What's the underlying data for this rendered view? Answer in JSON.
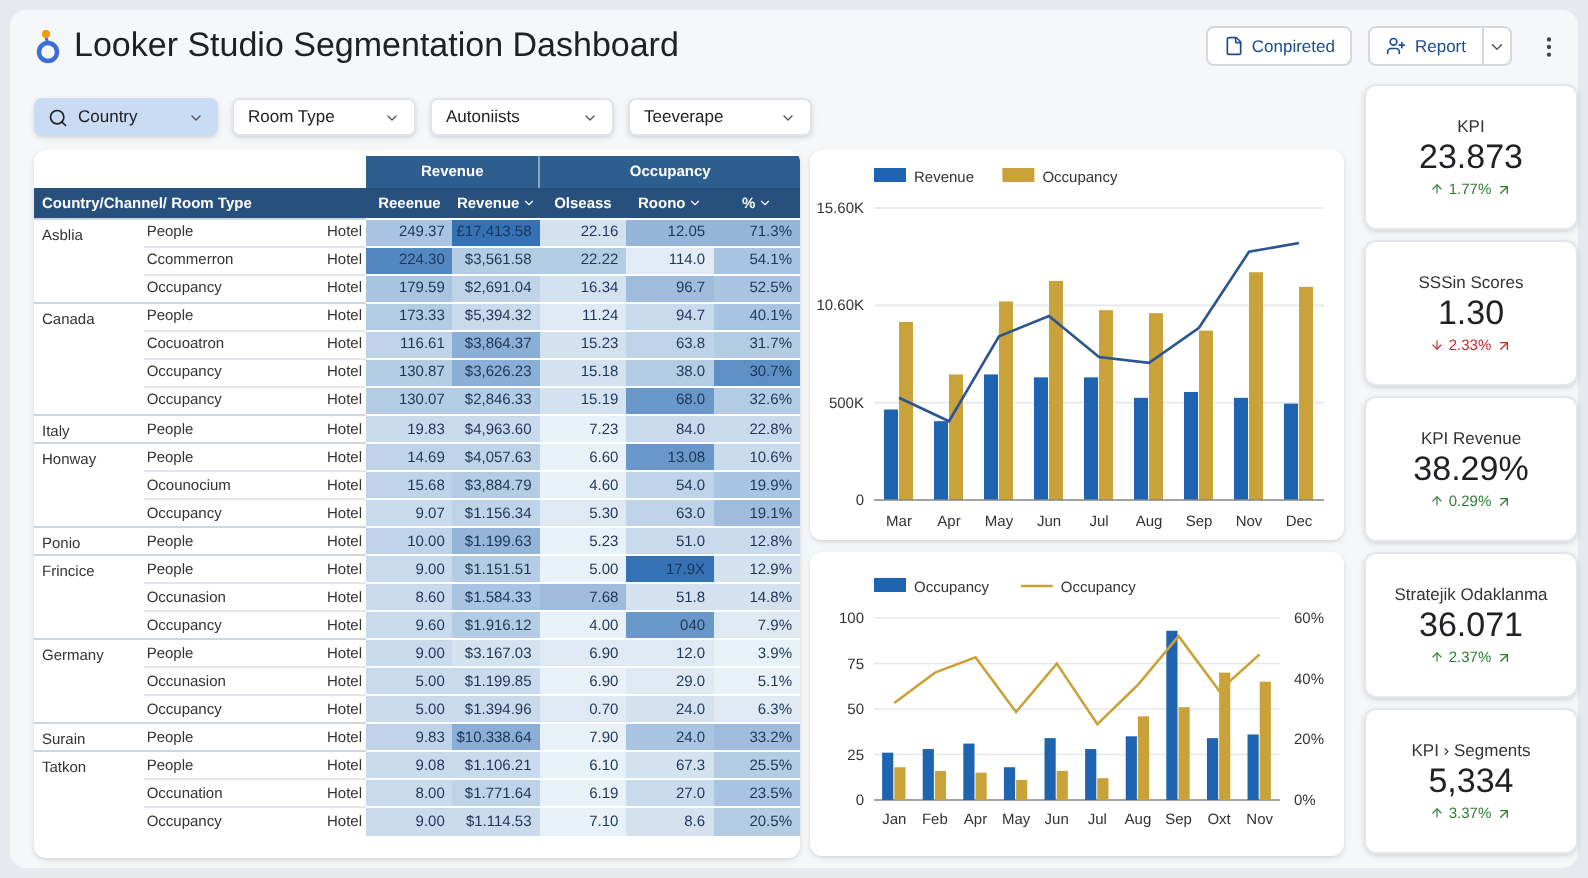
{
  "header": {
    "title": "Looker Studio Segmentation Dashboard",
    "buttons": [
      {
        "label": "Conpireted",
        "kind": "file",
        "split": false
      },
      {
        "label": "Report",
        "kind": "share",
        "split": true
      }
    ]
  },
  "filters": [
    {
      "label": "Country",
      "selected": true,
      "kind": "search"
    },
    {
      "label": "Room Type",
      "selected": false,
      "kind": "plain"
    },
    {
      "label": "Autoniists",
      "selected": false,
      "kind": "plain"
    },
    {
      "label": "Teeverape",
      "selected": false,
      "kind": "plain"
    }
  ],
  "table": {
    "group_headers": [
      "Revenue",
      "Occupancy"
    ],
    "row_header": "Country/Channel/ Room Type",
    "columns": [
      {
        "label": "Reeenue",
        "sortable": false
      },
      {
        "label": "Revenue",
        "sortable": true
      },
      {
        "label": "Olseass",
        "sortable": false
      },
      {
        "label": "Roono",
        "sortable": true
      },
      {
        "label": "%",
        "sortable": true
      }
    ],
    "groups": [
      {
        "country": "Asblia",
        "rows": [
          {
            "channel": "People",
            "type": "Hotel",
            "cells": [
              {
                "text": "249.37",
                "color": "#a9c4e0"
              },
              {
                "text": "£17,413.58",
                "color": "#3472b5"
              },
              {
                "text": "22.16",
                "color": "#d4e2f0"
              },
              {
                "text": "12.05",
                "color": "#94b5d8"
              },
              {
                "text": "71.3%",
                "color": "#94b5d8"
              }
            ]
          },
          {
            "channel": "Ccommerron",
            "type": "Hotel",
            "cells": [
              {
                "text": "224.30",
                "color": "#5488c1"
              },
              {
                "text": "$3,561.58",
                "color": "#b4cbe4"
              },
              {
                "text": "22.22",
                "color": "#b4cbe4"
              },
              {
                "text": "114.0",
                "color": "#e3ecf6"
              },
              {
                "text": "54.1%",
                "color": "#a9c4e0"
              }
            ]
          },
          {
            "channel": "Occupancy",
            "type": "Hotel",
            "cells": [
              {
                "text": "179.59",
                "color": "#a9c4e0"
              },
              {
                "text": "$2,691.04",
                "color": "#bfd3e8"
              },
              {
                "text": "16.34",
                "color": "#d4e2f0"
              },
              {
                "text": "96.7",
                "color": "#9fbcdc"
              },
              {
                "text": "52.5%",
                "color": "#a9c4e0"
              }
            ]
          }
        ]
      },
      {
        "country": "Canada",
        "rows": [
          {
            "channel": "People",
            "type": "Hotel",
            "cells": [
              {
                "text": "173.33",
                "color": "#b4cbe4"
              },
              {
                "text": "$5,394.32",
                "color": "#c9daec"
              },
              {
                "text": "11.24",
                "color": "#dfe9f4"
              },
              {
                "text": "94.7",
                "color": "#c9daec"
              },
              {
                "text": "40.1%",
                "color": "#a9c4e0"
              }
            ]
          },
          {
            "channel": "Cocuoatron",
            "type": "Hotel",
            "cells": [
              {
                "text": "116.61",
                "color": "#bfd3e8"
              },
              {
                "text": "$3,864.37",
                "color": "#8aaed5"
              },
              {
                "text": "15.23",
                "color": "#d4e2f0"
              },
              {
                "text": "63.8",
                "color": "#bfd3e8"
              },
              {
                "text": "31.7%",
                "color": "#b4cbe4"
              }
            ]
          },
          {
            "channel": "Occupancy",
            "type": "Hotel",
            "cells": [
              {
                "text": "130.87",
                "color": "#b4cbe4"
              },
              {
                "text": "$3,626.23",
                "color": "#8aaed5"
              },
              {
                "text": "15.18",
                "color": "#d4e2f0"
              },
              {
                "text": "38.0",
                "color": "#b4cbe4"
              },
              {
                "text": "30.7%",
                "color": "#5f90c5"
              }
            ]
          },
          {
            "channel": "Occupancy",
            "type": "Hotel",
            "cells": [
              {
                "text": "130.07",
                "color": "#b4cbe4"
              },
              {
                "text": "$2,846.33",
                "color": "#b4cbe4"
              },
              {
                "text": "15.19",
                "color": "#d4e2f0"
              },
              {
                "text": "68.0",
                "color": "#6a97c9"
              },
              {
                "text": "32.6%",
                "color": "#b4cbe4"
              }
            ]
          }
        ]
      },
      {
        "country": "Italy",
        "rows": [
          {
            "channel": "People",
            "type": "Hotel",
            "cells": [
              {
                "text": "19.83",
                "color": "#c9daec"
              },
              {
                "text": "$4,963.60",
                "color": "#c9daec"
              },
              {
                "text": "7.23",
                "color": "#e9f1f8"
              },
              {
                "text": "84.0",
                "color": "#c9daec"
              },
              {
                "text": "22.8%",
                "color": "#c9daec"
              }
            ]
          }
        ]
      },
      {
        "country": "Honway",
        "rows": [
          {
            "channel": "People",
            "type": "Hotel",
            "cells": [
              {
                "text": "14.69",
                "color": "#bfd3e8"
              },
              {
                "text": "$4,057.63",
                "color": "#bfd3e8"
              },
              {
                "text": "6.60",
                "color": "#e9f1f8"
              },
              {
                "text": "13.08",
                "color": "#6a97c9"
              },
              {
                "text": "10.6%",
                "color": "#c9daec"
              }
            ]
          },
          {
            "channel": "Ocounocium",
            "type": "Hotel",
            "cells": [
              {
                "text": "15.68",
                "color": "#bfd3e8"
              },
              {
                "text": "$3,884.79",
                "color": "#b4cbe4"
              },
              {
                "text": "4.60",
                "color": "#e9f1f8"
              },
              {
                "text": "54.0",
                "color": "#bfd3e8"
              },
              {
                "text": "19.9%",
                "color": "#a9c4e0"
              }
            ]
          },
          {
            "channel": "Occupancy",
            "type": "Hotel",
            "cells": [
              {
                "text": "9.07",
                "color": "#c9daec"
              },
              {
                "text": "$1.156.34",
                "color": "#bfd3e8"
              },
              {
                "text": "5.30",
                "color": "#dfe9f4"
              },
              {
                "text": "63.0",
                "color": "#bfd3e8"
              },
              {
                "text": "19.1%",
                "color": "#9fbcdc"
              }
            ]
          }
        ]
      },
      {
        "country": "Ponio",
        "rows": [
          {
            "channel": "People",
            "type": "Hotel",
            "cells": [
              {
                "text": "10.00",
                "color": "#bfd3e8"
              },
              {
                "text": "$1.199.63",
                "color": "#94b5d8"
              },
              {
                "text": "5.23",
                "color": "#e9f1f8"
              },
              {
                "text": "51.0",
                "color": "#c9daec"
              },
              {
                "text": "12.8%",
                "color": "#c9daec"
              }
            ]
          }
        ]
      },
      {
        "country": "Frincice",
        "rows": [
          {
            "channel": "People",
            "type": "Hotel",
            "cells": [
              {
                "text": "9.00",
                "color": "#c9daec"
              },
              {
                "text": "$1.151.51",
                "color": "#b4cbe4"
              },
              {
                "text": "5.00",
                "color": "#e9f1f8"
              },
              {
                "text": "17.9X",
                "color": "#3472b5"
              },
              {
                "text": "12.9%",
                "color": "#d4e2f0"
              }
            ]
          },
          {
            "channel": "Occunasion",
            "type": "Hotel",
            "cells": [
              {
                "text": "8.60",
                "color": "#c9daec"
              },
              {
                "text": "$1.584.33",
                "color": "#a9c4e0"
              },
              {
                "text": "7.68",
                "color": "#9fbcdc"
              },
              {
                "text": "51.8",
                "color": "#d4e2f0"
              },
              {
                "text": "14.8%",
                "color": "#d4e2f0"
              }
            ]
          },
          {
            "channel": "Occupancy",
            "type": "Hotel",
            "cells": [
              {
                "text": "9.60",
                "color": "#c9daec"
              },
              {
                "text": "$1.916.12",
                "color": "#b4cbe4"
              },
              {
                "text": "4.00",
                "color": "#e9f1f8"
              },
              {
                "text": "040",
                "color": "#6a97c9"
              },
              {
                "text": "7.9%",
                "color": "#dfe9f4"
              }
            ]
          }
        ]
      },
      {
        "country": "Germany",
        "rows": [
          {
            "channel": "People",
            "type": "Hotel",
            "cells": [
              {
                "text": "9.00",
                "color": "#c9daec"
              },
              {
                "text": "$3.167.03",
                "color": "#d4e2f0"
              },
              {
                "text": "6.90",
                "color": "#dfe9f4"
              },
              {
                "text": "12.0",
                "color": "#dfe9f4"
              },
              {
                "text": "3.9%",
                "color": "#e9f1f8"
              }
            ]
          },
          {
            "channel": "Occunasion",
            "type": "Hotel",
            "cells": [
              {
                "text": "5.00",
                "color": "#c9daec"
              },
              {
                "text": "$1.199.85",
                "color": "#c9daec"
              },
              {
                "text": "6.90",
                "color": "#e9f1f8"
              },
              {
                "text": "29.0",
                "color": "#dfe9f4"
              },
              {
                "text": "5.1%",
                "color": "#e9f1f8"
              }
            ]
          },
          {
            "channel": "Occupancy",
            "type": "Hotel",
            "cells": [
              {
                "text": "5.00",
                "color": "#c9daec"
              },
              {
                "text": "$1.394.96",
                "color": "#c9daec"
              },
              {
                "text": "0.70",
                "color": "#dfe9f4"
              },
              {
                "text": "24.0",
                "color": "#d4e2f0"
              },
              {
                "text": "6.3%",
                "color": "#dfe9f4"
              }
            ]
          }
        ]
      },
      {
        "country": "Surain",
        "rows": [
          {
            "channel": "People",
            "type": "Hotel",
            "cells": [
              {
                "text": "9.83",
                "color": "#bfd3e8"
              },
              {
                "text": "$10.338.64",
                "color": "#8aaed5"
              },
              {
                "text": "7.90",
                "color": "#e9f1f8"
              },
              {
                "text": "24.0",
                "color": "#a9c4e0"
              },
              {
                "text": "33.2%",
                "color": "#9fbcdc"
              }
            ]
          }
        ]
      },
      {
        "country": "Tatkon",
        "rows": [
          {
            "channel": "People",
            "type": "Hotel",
            "cells": [
              {
                "text": "9.08",
                "color": "#c9daec"
              },
              {
                "text": "$1.106.21",
                "color": "#c9daec"
              },
              {
                "text": "6.10",
                "color": "#e9f1f8"
              },
              {
                "text": "67.3",
                "color": "#d4e2f0"
              },
              {
                "text": "25.5%",
                "color": "#b4cbe4"
              }
            ]
          },
          {
            "channel": "Occunation",
            "type": "Hotel",
            "cells": [
              {
                "text": "8.00",
                "color": "#c9daec"
              },
              {
                "text": "$1.771.64",
                "color": "#bfd3e8"
              },
              {
                "text": "6.19",
                "color": "#e9f1f8"
              },
              {
                "text": "27.0",
                "color": "#c9daec"
              },
              {
                "text": "23.5%",
                "color": "#a9c4e0"
              }
            ]
          },
          {
            "channel": "Occupancy",
            "type": "Hotel",
            "cells": [
              {
                "text": "9.00",
                "color": "#c9daec"
              },
              {
                "text": "$1.114.53",
                "color": "#c9daec"
              },
              {
                "text": "7.10",
                "color": "#e9f1f8"
              },
              {
                "text": "8.6",
                "color": "#d4e2f0"
              },
              {
                "text": "20.5%",
                "color": "#b4cbe4"
              }
            ]
          }
        ]
      }
    ]
  },
  "charts": [
    {
      "kind": "picture",
      "legend": [
        "Revenue",
        "Occupancy"
      ],
      "y_axis_labels": [
        "15.60K",
        "10.60K",
        "500K",
        "0"
      ],
      "x_axis_labels": [
        "Mar",
        "Apr",
        "May",
        "Jun",
        "Jul",
        "Aug",
        "Sep",
        "Nov",
        "Dec"
      ]
    },
    {
      "chart_data": {
        "type": "bar",
        "stacked": false,
        "grid": true,
        "legend": "top",
        "categories": [
          "Jan",
          "Feb",
          "Apr",
          "May",
          "Jun",
          "Jul",
          "Aug",
          "Sep",
          "Oxt",
          "Nov"
        ],
        "ylim": [
          0,
          100
        ],
        "yticks": [
          0,
          25,
          50,
          75,
          100
        ],
        "y2lim": [
          0,
          60
        ],
        "y2ticks": [
          {
            "value": 0,
            "label": "0%"
          },
          {
            "value": 20,
            "label": "20%"
          },
          {
            "value": 40,
            "label": "40%"
          },
          {
            "value": 60,
            "label": "60%"
          }
        ],
        "series": [
          {
            "name": "Occupancy",
            "type": "bar",
            "color": "#1f64b0",
            "values": [
              26,
              28,
              31,
              18,
              34,
              28,
              35,
              93,
              34,
              36
            ]
          },
          {
            "type": "bar",
            "color": "#c9a23a",
            "values": [
              18,
              16,
              15,
              11,
              16,
              12,
              46,
              51,
              70,
              65
            ]
          },
          {
            "name": "Occupancy",
            "type": "line",
            "axis": "y2",
            "color": "#c9a23a",
            "values": [
              32,
              42,
              47,
              29,
              45,
              25,
              38,
              54,
              36,
              48
            ]
          }
        ]
      }
    }
  ],
  "kpis": [
    {
      "title": "KPI",
      "value": "23.873",
      "delta": "1.77%",
      "positive": true
    },
    {
      "title": "SSSin Scores",
      "value": "1.30",
      "delta": "2.33%",
      "positive": false
    },
    {
      "title": "KPI Revenue",
      "value": "38.29%",
      "delta": "0.29%",
      "positive": true
    },
    {
      "title": "Stratejik Odaklanma",
      "value": "36.071",
      "delta": "2.37%",
      "positive": true
    },
    {
      "title": "KPI › Segments",
      "value": "5,334",
      "delta": "3.37%",
      "positive": true
    }
  ]
}
